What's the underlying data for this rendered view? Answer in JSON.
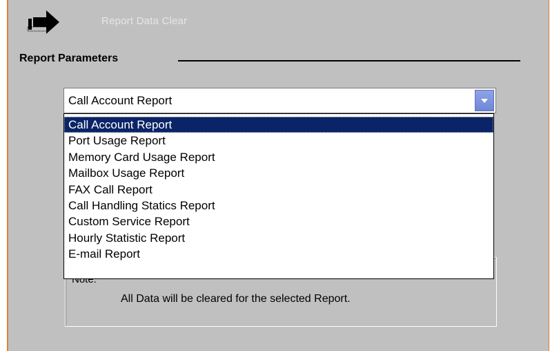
{
  "header": {
    "title": "Report Data Clear",
    "icon": "arrow-right-icon"
  },
  "section": {
    "title": "Report Parameters"
  },
  "report_select": {
    "value": "Call Account Report",
    "options": [
      "Call Account Report",
      "Port Usage Report",
      "Memory Card Usage Report",
      "Mailbox Usage Report",
      "FAX Call Report",
      "Call Handling Statics Report",
      "Custom Service Report",
      "Hourly Statistic Report",
      "E-mail Report"
    ],
    "selected_index": 0
  },
  "note": {
    "label": "Note:",
    "text": "All Data will be cleared for the selected Report."
  },
  "colors": {
    "panel_bg": "#c0c0c0",
    "border_accent": "#e07e3c",
    "selection_bg": "#0b2467",
    "dropdown_button": "#7d93df"
  }
}
